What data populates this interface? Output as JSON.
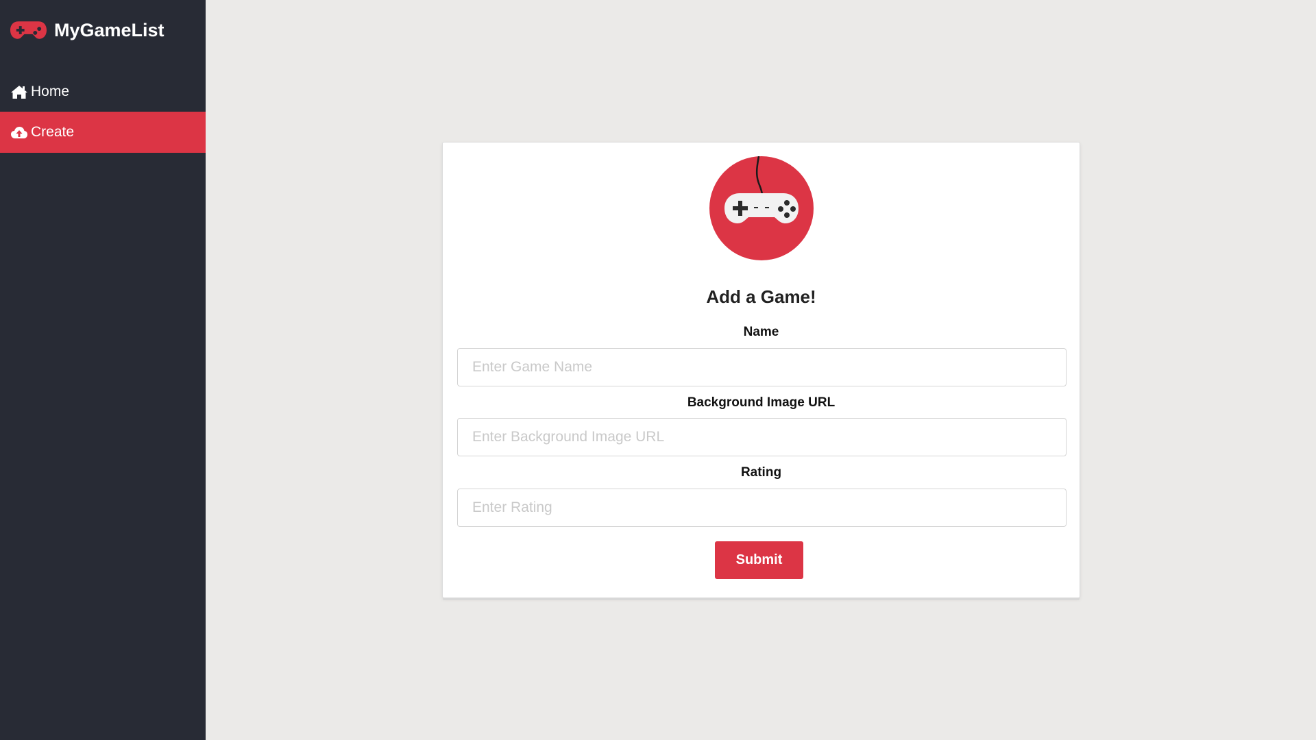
{
  "app": {
    "title": "MyGameList",
    "logo_icon": "gamepad-icon"
  },
  "sidebar": {
    "items": [
      {
        "label": "Home",
        "icon": "home-icon",
        "active": false
      },
      {
        "label": "Create",
        "icon": "cloud-upload-icon",
        "active": true
      }
    ]
  },
  "form": {
    "logo_icon": "game-controller-icon",
    "heading": "Add a Game!",
    "fields": [
      {
        "label": "Name",
        "placeholder": "Enter Game Name",
        "value": ""
      },
      {
        "label": "Background Image URL",
        "placeholder": "Enter Background Image URL",
        "value": ""
      },
      {
        "label": "Rating",
        "placeholder": "Enter Rating",
        "value": ""
      }
    ],
    "submit_label": "Submit"
  },
  "colors": {
    "accent": "#dc3545",
    "sidebar_bg": "#282b35",
    "page_bg": "#ebeae8",
    "card_bg": "#ffffff"
  }
}
